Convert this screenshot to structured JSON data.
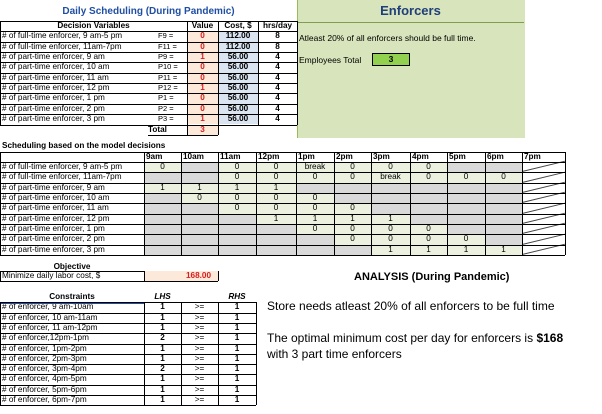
{
  "title": "Daily Scheduling (During Pandemic)",
  "header_cols": {
    "vars": "Decision Variables",
    "value": "Value",
    "cost": "Cost, $",
    "hrs": "hrs/day"
  },
  "decision_rows": [
    {
      "label": "# of full-time enforcer, 9 am-5 pm",
      "sym": "F9 =",
      "value": "0",
      "cost": "112.00",
      "hrs": "8"
    },
    {
      "label": "# of full-time enforcer, 11am-7pm",
      "sym": "F11 =",
      "value": "0",
      "cost": "112.00",
      "hrs": "8"
    },
    {
      "label": "# of part-time enforcer, 9 am",
      "sym": "P9 =",
      "value": "1",
      "cost": "56.00",
      "hrs": "4"
    },
    {
      "label": "# of part-time enforcer, 10 am",
      "sym": "P10 =",
      "value": "0",
      "cost": "56.00",
      "hrs": "4"
    },
    {
      "label": "# of part-time enforcer, 11 am",
      "sym": "P11 =",
      "value": "0",
      "cost": "56.00",
      "hrs": "4"
    },
    {
      "label": "# of part-time enforcer, 12 pm",
      "sym": "P12 =",
      "value": "1",
      "cost": "56.00",
      "hrs": "4"
    },
    {
      "label": "# of part-time enforcer, 1 pm",
      "sym": "P1 =",
      "value": "0",
      "cost": "56.00",
      "hrs": "4"
    },
    {
      "label": "# of part-time enforcer, 2 pm",
      "sym": "P2 =",
      "value": "0",
      "cost": "56.00",
      "hrs": "4"
    },
    {
      "label": "# of part-time enforcer, 3 pm",
      "sym": "P3 =",
      "value": "1",
      "cost": "56.00",
      "hrs": "4"
    }
  ],
  "total_label": "Total",
  "total_value": "3",
  "enforcers_title": "Enforcers",
  "enforcers_note": "Atleast 20% of all enforcers should be full time.",
  "employees_total_label": "Employees Total",
  "employees_total_value": "3",
  "schedule_title": "Scheduling based on the model decisions",
  "schedule_hours": [
    "9am",
    "10am",
    "11am",
    "12pm",
    "1pm",
    "2pm",
    "3pm",
    "4pm",
    "5pm",
    "6pm",
    "7pm"
  ],
  "schedule_rows": [
    {
      "label": "# of full-time enforcer, 9 am-5 pm",
      "cells": [
        "0",
        "",
        "0",
        "0",
        "break",
        "0",
        "0",
        "0",
        "",
        "",
        "X"
      ]
    },
    {
      "label": "# of full-time enforcer, 11am-7pm",
      "cells": [
        "",
        "",
        "0",
        "0",
        "0",
        "0",
        "break",
        "0",
        "0",
        "0",
        "X"
      ]
    },
    {
      "label": "# of part-time enforcer, 9 am",
      "cells": [
        "1",
        "1",
        "1",
        "1",
        "",
        "",
        "",
        "",
        "",
        "",
        "X"
      ]
    },
    {
      "label": "# of part-time enforcer, 10 am",
      "cells": [
        "",
        "0",
        "0",
        "0",
        "0",
        "",
        "",
        "",
        "",
        "",
        "X"
      ]
    },
    {
      "label": "# of part-time enforcer, 11 am",
      "cells": [
        "",
        "",
        "0",
        "0",
        "0",
        "0",
        "",
        "",
        "",
        "",
        "X"
      ]
    },
    {
      "label": "# of part-time enforcer, 12 pm",
      "cells": [
        "",
        "",
        "",
        "1",
        "1",
        "1",
        "1",
        "",
        "",
        "",
        "X"
      ]
    },
    {
      "label": "# of part-time enforcer, 1 pm",
      "cells": [
        "",
        "",
        "",
        "",
        "0",
        "0",
        "0",
        "0",
        "",
        "",
        "X"
      ]
    },
    {
      "label": "# of part-time enforcer, 2 pm",
      "cells": [
        "",
        "",
        "",
        "",
        "",
        "0",
        "0",
        "0",
        "0",
        "",
        "X"
      ]
    },
    {
      "label": "# of part-time enforcer, 3 pm",
      "cells": [
        "",
        "",
        "",
        "",
        "",
        "",
        "1",
        "1",
        "1",
        "1",
        "X"
      ]
    }
  ],
  "objective_title": "Objective",
  "objective_label": "Minimize daily labor cost, $",
  "objective_value": "168.00",
  "analysis_title": "ANALYSIS (During Pandemic)",
  "analysis_line1": "Store needs atleast 20% of all enforcers to be full time",
  "analysis_line2_pre": "The optimal minimum cost per day for enforcers is ",
  "analysis_line2_bold": "$168",
  "analysis_line3": "with 3 part time enforcers",
  "constraints_headers": {
    "name": "Constraints",
    "lhs": "LHS",
    "rhs": "RHS"
  },
  "constraints": [
    {
      "name": "# of enforcer, 9 am-10am",
      "lhs": "1",
      "op": ">=",
      "rhs": "1"
    },
    {
      "name": "# of enforcer, 10 am-11am",
      "lhs": "1",
      "op": ">=",
      "rhs": "1"
    },
    {
      "name": "# of enforcer, 11 am-12pm",
      "lhs": "1",
      "op": ">=",
      "rhs": "1"
    },
    {
      "name": "# of enforcer,12pm-1pm",
      "lhs": "2",
      "op": ">=",
      "rhs": "1"
    },
    {
      "name": "# of enforcer, 1pm-2pm",
      "lhs": "1",
      "op": ">=",
      "rhs": "1"
    },
    {
      "name": "# of enforcer, 2pm-3pm",
      "lhs": "1",
      "op": ">=",
      "rhs": "1"
    },
    {
      "name": "# of enforcer, 3pm-4pm",
      "lhs": "2",
      "op": ">=",
      "rhs": "1"
    },
    {
      "name": "# of enforcer, 4pm-5pm",
      "lhs": "1",
      "op": ">=",
      "rhs": "1"
    },
    {
      "name": "# of enforcer, 5pm-6pm",
      "lhs": "1",
      "op": ">=",
      "rhs": "1"
    },
    {
      "name": "# of enforcer, 6pm-7pm",
      "lhs": "1",
      "op": ">=",
      "rhs": "1"
    }
  ],
  "colors": {
    "value_bg": "#fde9d9",
    "cost_bg": "#dbe5f1",
    "title_blue": "#1f4ea3",
    "enforcers_bg": "#d8e4bc",
    "green_cell": "#ebf1de",
    "emp_total_bg": "#92d050",
    "gray_cell": "#d9d9d9",
    "red_text": "#d81e1e"
  }
}
